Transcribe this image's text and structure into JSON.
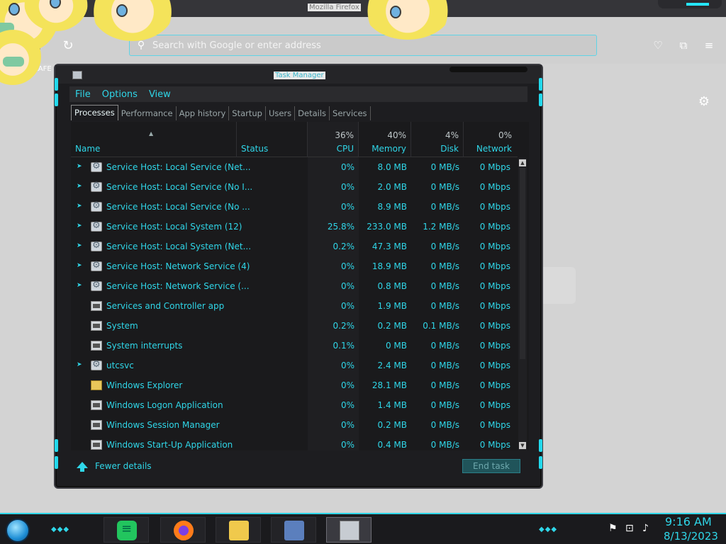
{
  "firefox": {
    "window_title": "Mozilla Firefox",
    "address_placeholder": "Search with Google or enter address",
    "tab_label": "LAFE"
  },
  "taskmanager": {
    "title": "Task Manager",
    "menu": [
      "File",
      "Options",
      "View"
    ],
    "tabs": [
      "Processes",
      "Performance",
      "App history",
      "Startup",
      "Users",
      "Details",
      "Services"
    ],
    "columns": {
      "name": "Name",
      "status": "Status",
      "cpu": {
        "label": "CPU",
        "pct": "36%"
      },
      "memory": {
        "label": "Memory",
        "pct": "40%"
      },
      "disk": {
        "label": "Disk",
        "pct": "4%"
      },
      "network": {
        "label": "Network",
        "pct": "0%"
      }
    },
    "rows": [
      {
        "name": "Service Host: Local Service (Net...",
        "icon": "gear-icon",
        "expand": true,
        "cpu": "0%",
        "memory": "8.0 MB",
        "disk": "0 MB/s",
        "network": "0 Mbps"
      },
      {
        "name": "Service Host: Local Service (No I...",
        "icon": "gear-icon",
        "expand": true,
        "cpu": "0%",
        "memory": "2.0 MB",
        "disk": "0 MB/s",
        "network": "0 Mbps"
      },
      {
        "name": "Service Host: Local Service (No ...",
        "icon": "gear-icon",
        "expand": true,
        "cpu": "0%",
        "memory": "8.9 MB",
        "disk": "0 MB/s",
        "network": "0 Mbps"
      },
      {
        "name": "Service Host: Local System (12)",
        "icon": "gear-icon",
        "expand": true,
        "cpu": "25.8%",
        "memory": "233.0 MB",
        "disk": "1.2 MB/s",
        "network": "0 Mbps"
      },
      {
        "name": "Service Host: Local System (Net...",
        "icon": "gear-icon",
        "expand": true,
        "cpu": "0.2%",
        "memory": "47.3 MB",
        "disk": "0 MB/s",
        "network": "0 Mbps"
      },
      {
        "name": "Service Host: Network Service (4)",
        "icon": "gear-icon",
        "expand": true,
        "cpu": "0%",
        "memory": "18.9 MB",
        "disk": "0 MB/s",
        "network": "0 Mbps"
      },
      {
        "name": "Service Host: Network Service (...",
        "icon": "gear-icon",
        "expand": true,
        "cpu": "0%",
        "memory": "0.8 MB",
        "disk": "0 MB/s",
        "network": "0 Mbps"
      },
      {
        "name": "Services and Controller app",
        "icon": "window-icon",
        "expand": false,
        "cpu": "0%",
        "memory": "1.9 MB",
        "disk": "0 MB/s",
        "network": "0 Mbps"
      },
      {
        "name": "System",
        "icon": "window-icon",
        "expand": false,
        "cpu": "0.2%",
        "memory": "0.2 MB",
        "disk": "0.1 MB/s",
        "network": "0 Mbps"
      },
      {
        "name": "System interrupts",
        "icon": "window-icon",
        "expand": false,
        "cpu": "0.1%",
        "memory": "0 MB",
        "disk": "0 MB/s",
        "network": "0 Mbps"
      },
      {
        "name": "utcsvc",
        "icon": "gear-icon",
        "expand": true,
        "cpu": "0%",
        "memory": "2.4 MB",
        "disk": "0 MB/s",
        "network": "0 Mbps"
      },
      {
        "name": "Windows Explorer",
        "icon": "folder-icon",
        "expand": false,
        "cpu": "0%",
        "memory": "28.1 MB",
        "disk": "0 MB/s",
        "network": "0 Mbps"
      },
      {
        "name": "Windows Logon Application",
        "icon": "window-icon",
        "expand": false,
        "cpu": "0%",
        "memory": "1.4 MB",
        "disk": "0 MB/s",
        "network": "0 Mbps"
      },
      {
        "name": "Windows Session Manager",
        "icon": "window-icon",
        "expand": false,
        "cpu": "0%",
        "memory": "0.2 MB",
        "disk": "0 MB/s",
        "network": "0 Mbps"
      },
      {
        "name": "Windows Start-Up Application",
        "icon": "window-icon",
        "expand": false,
        "cpu": "0%",
        "memory": "0.4 MB",
        "disk": "0 MB/s",
        "network": "0 Mbps"
      }
    ],
    "footer": {
      "fewer_details": "Fewer details",
      "end_task": "End task"
    }
  },
  "taskbar": {
    "apps": [
      "notes-icon",
      "firefox-icon",
      "file-explorer-icon",
      "keyboard-icon",
      "task-manager-icon"
    ],
    "clock_time": "9:16 AM",
    "clock_date": "8/13/2023"
  },
  "colors": {
    "accent": "#2fd6e8",
    "window_bg": "#1d1d20"
  }
}
